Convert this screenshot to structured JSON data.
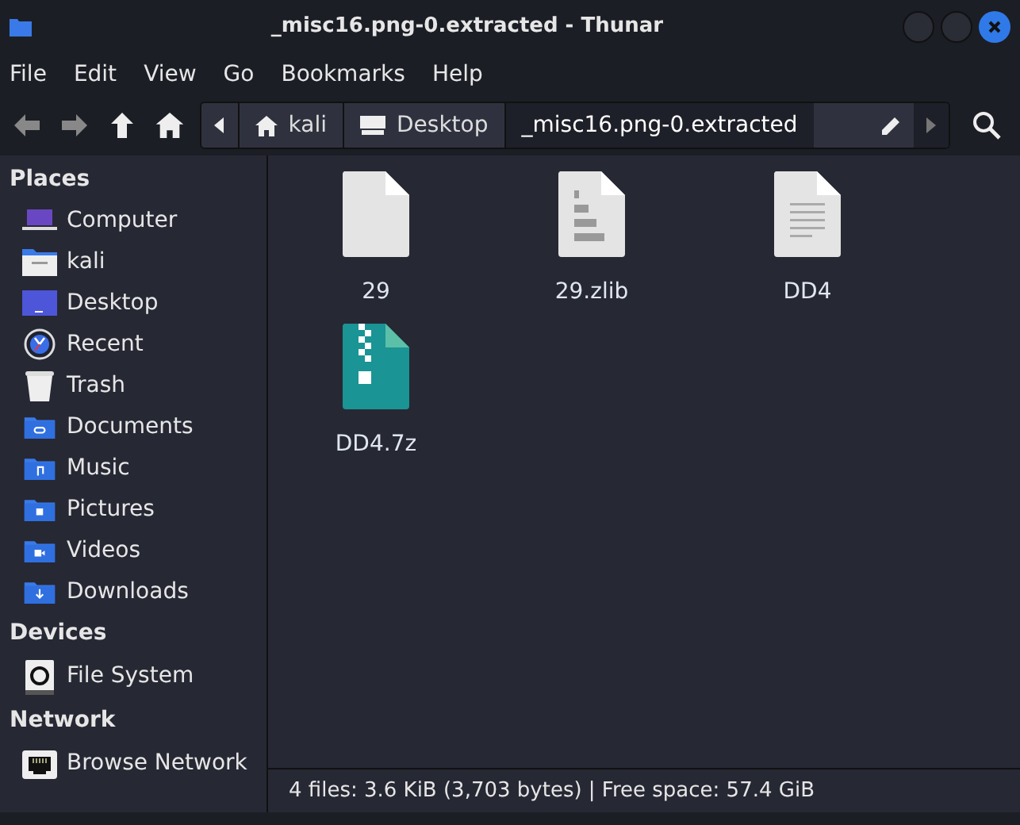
{
  "window": {
    "title": "_misc16.png-0.extracted - Thunar"
  },
  "menu": [
    "File",
    "Edit",
    "View",
    "Go",
    "Bookmarks",
    "Help"
  ],
  "path": [
    {
      "label": "kali",
      "kind": "home",
      "selected": false
    },
    {
      "label": "Desktop",
      "kind": "desktop",
      "selected": false
    },
    {
      "label": "_misc16.png-0.extracted",
      "kind": "folder",
      "selected": true
    }
  ],
  "sidebar": [
    {
      "heading": "Places",
      "items": [
        {
          "label": "Computer",
          "kind": "computer"
        },
        {
          "label": "kali",
          "kind": "home"
        },
        {
          "label": "Desktop",
          "kind": "desktop"
        },
        {
          "label": "Recent",
          "kind": "recent"
        },
        {
          "label": "Trash",
          "kind": "trash"
        },
        {
          "label": "Documents",
          "kind": "documents"
        },
        {
          "label": "Music",
          "kind": "music"
        },
        {
          "label": "Pictures",
          "kind": "pictures"
        },
        {
          "label": "Videos",
          "kind": "videos"
        },
        {
          "label": "Downloads",
          "kind": "downloads"
        }
      ]
    },
    {
      "heading": "Devices",
      "items": [
        {
          "label": "File System",
          "kind": "drive"
        }
      ]
    },
    {
      "heading": "Network",
      "items": [
        {
          "label": "Browse Network",
          "kind": "network"
        }
      ]
    }
  ],
  "files": [
    {
      "name": "29",
      "kind": "blank"
    },
    {
      "name": "29.zlib",
      "kind": "binary"
    },
    {
      "name": "DD4",
      "kind": "text"
    },
    {
      "name": "DD4.7z",
      "kind": "archive"
    }
  ],
  "status_bar": "4 files: 3.6 KiB (3,703 bytes) | Free space: 57.4 GiB"
}
